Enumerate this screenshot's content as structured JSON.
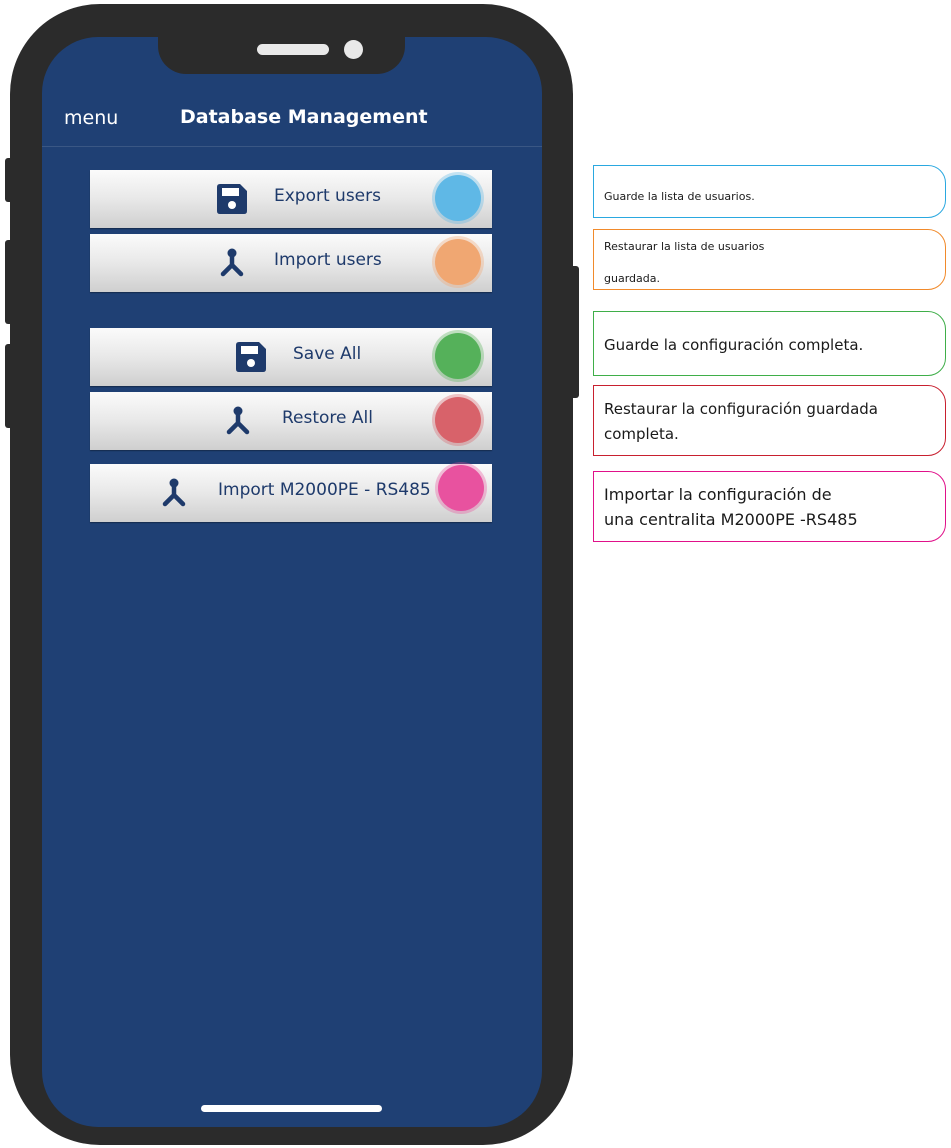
{
  "header": {
    "menu_label": "menu",
    "title": "Database Management"
  },
  "buttons": [
    {
      "label": "Export users",
      "icon": "floppy-disk-icon",
      "dot_color": "#5fb8e6"
    },
    {
      "label": "Import users",
      "icon": "network-import-icon",
      "dot_color": "#f0a772"
    },
    {
      "label": "Save All",
      "icon": "floppy-disk-icon",
      "dot_color": "#55b15a"
    },
    {
      "label": "Restore All",
      "icon": "network-import-icon",
      "dot_color": "#d8626a"
    },
    {
      "label": "Import M2000PE - RS485",
      "icon": "network-import-icon",
      "dot_color": "#e8529f"
    }
  ],
  "callouts": [
    {
      "lines": [
        "Guarde la lista de usuarios."
      ],
      "border_color": "#2aa8e0"
    },
    {
      "lines": [
        "Restaurar la lista de usuarios",
        "guardada."
      ],
      "border_color": "#f18a2b"
    },
    {
      "lines": [
        "Guarde la configuración completa."
      ],
      "border_color": "#3fae49"
    },
    {
      "lines": [
        "Restaurar la configuración guardada",
        "completa."
      ],
      "border_color": "#c8202f"
    },
    {
      "lines": [
        "Importar la configuración de",
        "una centralita M2000PE -RS485"
      ],
      "border_color": "#e0118a"
    }
  ]
}
